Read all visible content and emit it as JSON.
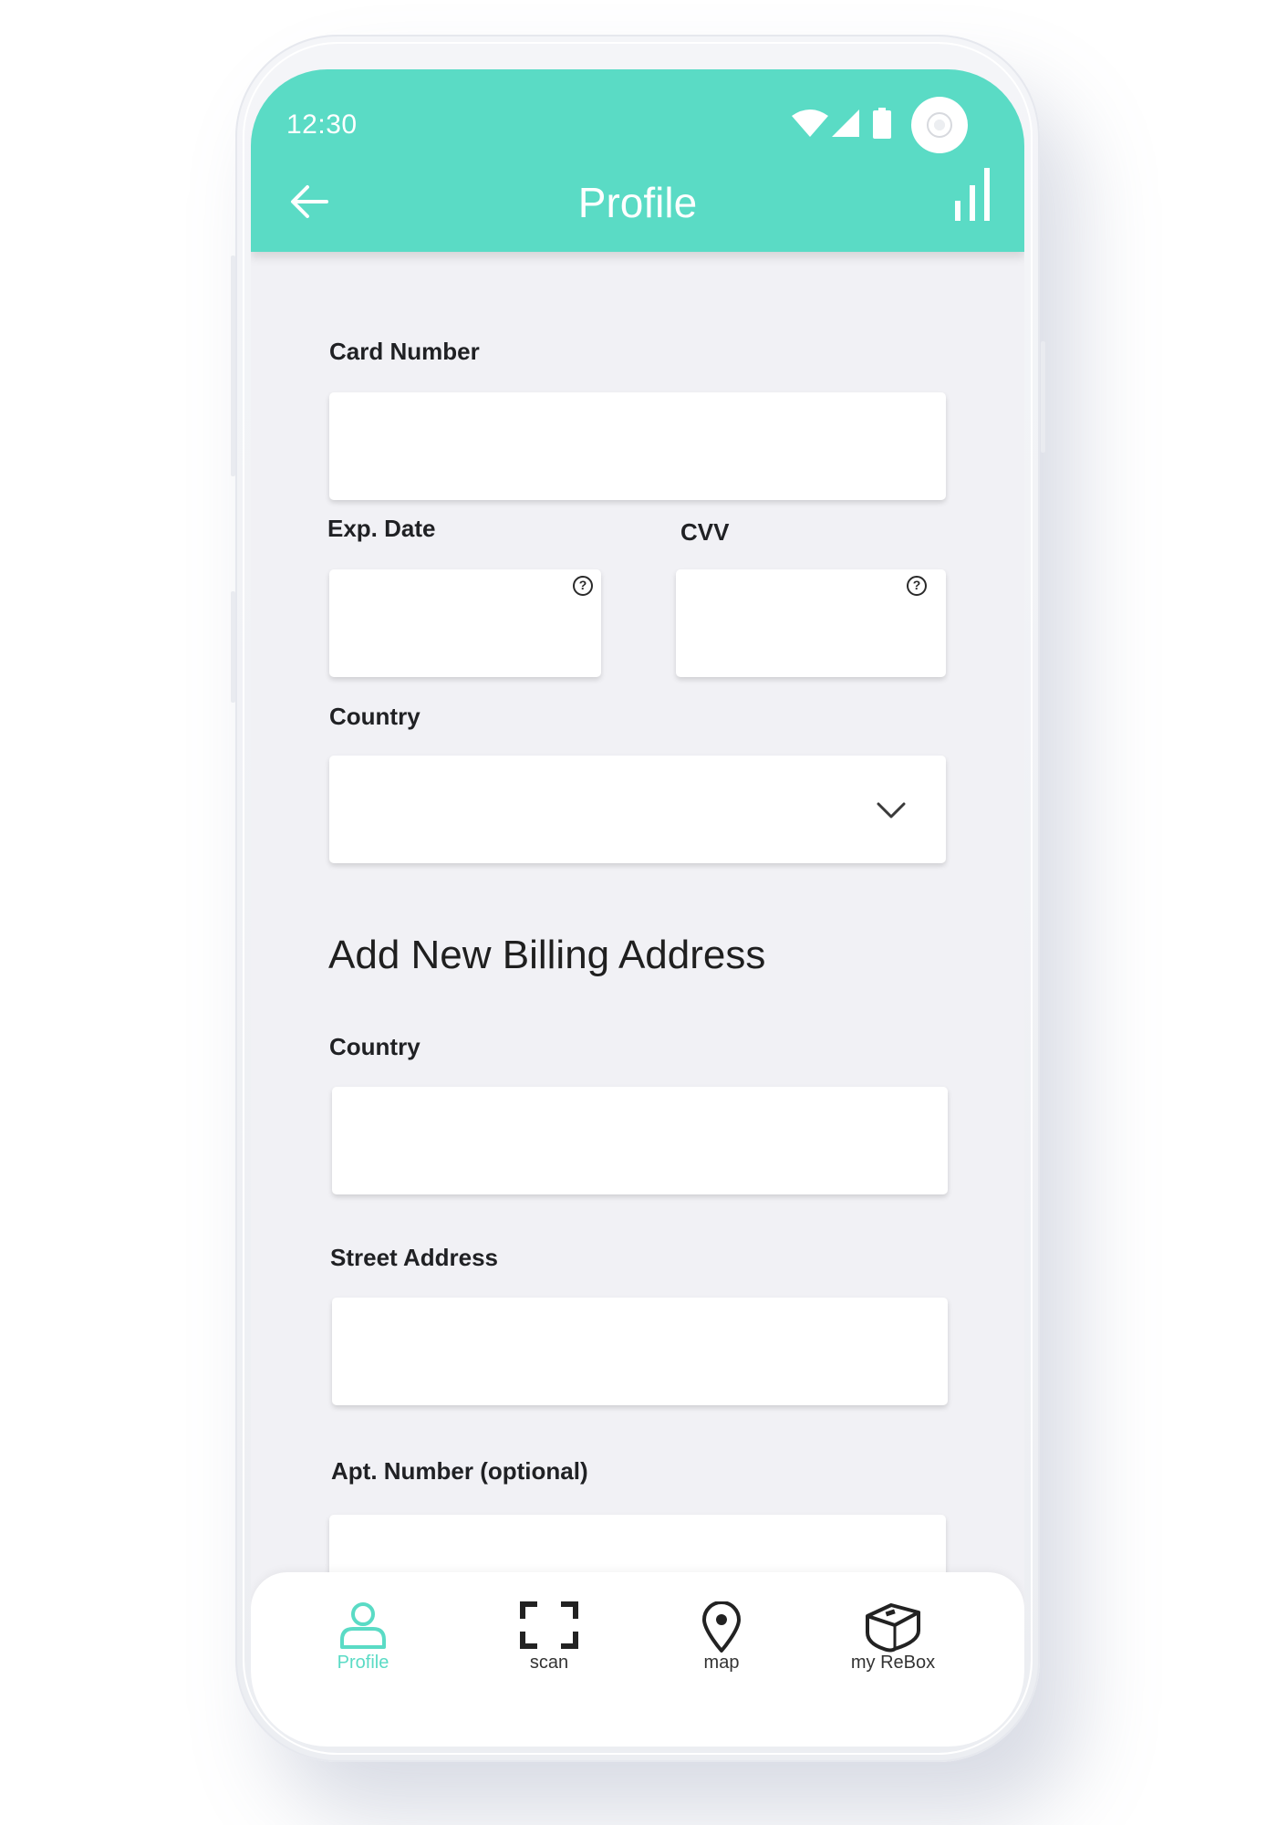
{
  "colors": {
    "accent": "#5adbc5",
    "screen_background": "#f1f1f5",
    "input_background": "#ffffff",
    "text": "#202124"
  },
  "status_bar": {
    "time": "12:30",
    "icons": [
      "wifi-icon",
      "cellular-signal-icon",
      "battery-icon",
      "front-camera"
    ]
  },
  "app_bar": {
    "title": "Profile",
    "left_icon": "back-arrow-icon",
    "right_icon": "bar-chart-icon"
  },
  "card_form": {
    "card_number": {
      "label": "Card Number",
      "value": "",
      "placeholder": ""
    },
    "exp_date": {
      "label": "Exp. Date",
      "value": "",
      "placeholder": "",
      "help_icon": "question-mark-icon"
    },
    "cvv": {
      "label": "CVV",
      "value": "",
      "placeholder": "",
      "help_icon": "question-mark-icon"
    },
    "country": {
      "label": "Country",
      "selected": "",
      "icon": "chevron-down-icon"
    }
  },
  "billing": {
    "title": "Add New Billing Address",
    "country": {
      "label": "Country",
      "value": "",
      "placeholder": ""
    },
    "street": {
      "label": "Street Address",
      "value": "",
      "placeholder": ""
    },
    "apt": {
      "label": "Apt. Number (optional)",
      "value": "",
      "placeholder": ""
    }
  },
  "bottom_nav": {
    "items": [
      {
        "label": "Profile",
        "icon": "user-icon",
        "active": true
      },
      {
        "label": "scan",
        "icon": "scan-frame-icon",
        "active": false
      },
      {
        "label": "map",
        "icon": "map-pin-icon",
        "active": false
      },
      {
        "label": "my ReBox",
        "icon": "box-icon",
        "active": false
      }
    ]
  }
}
